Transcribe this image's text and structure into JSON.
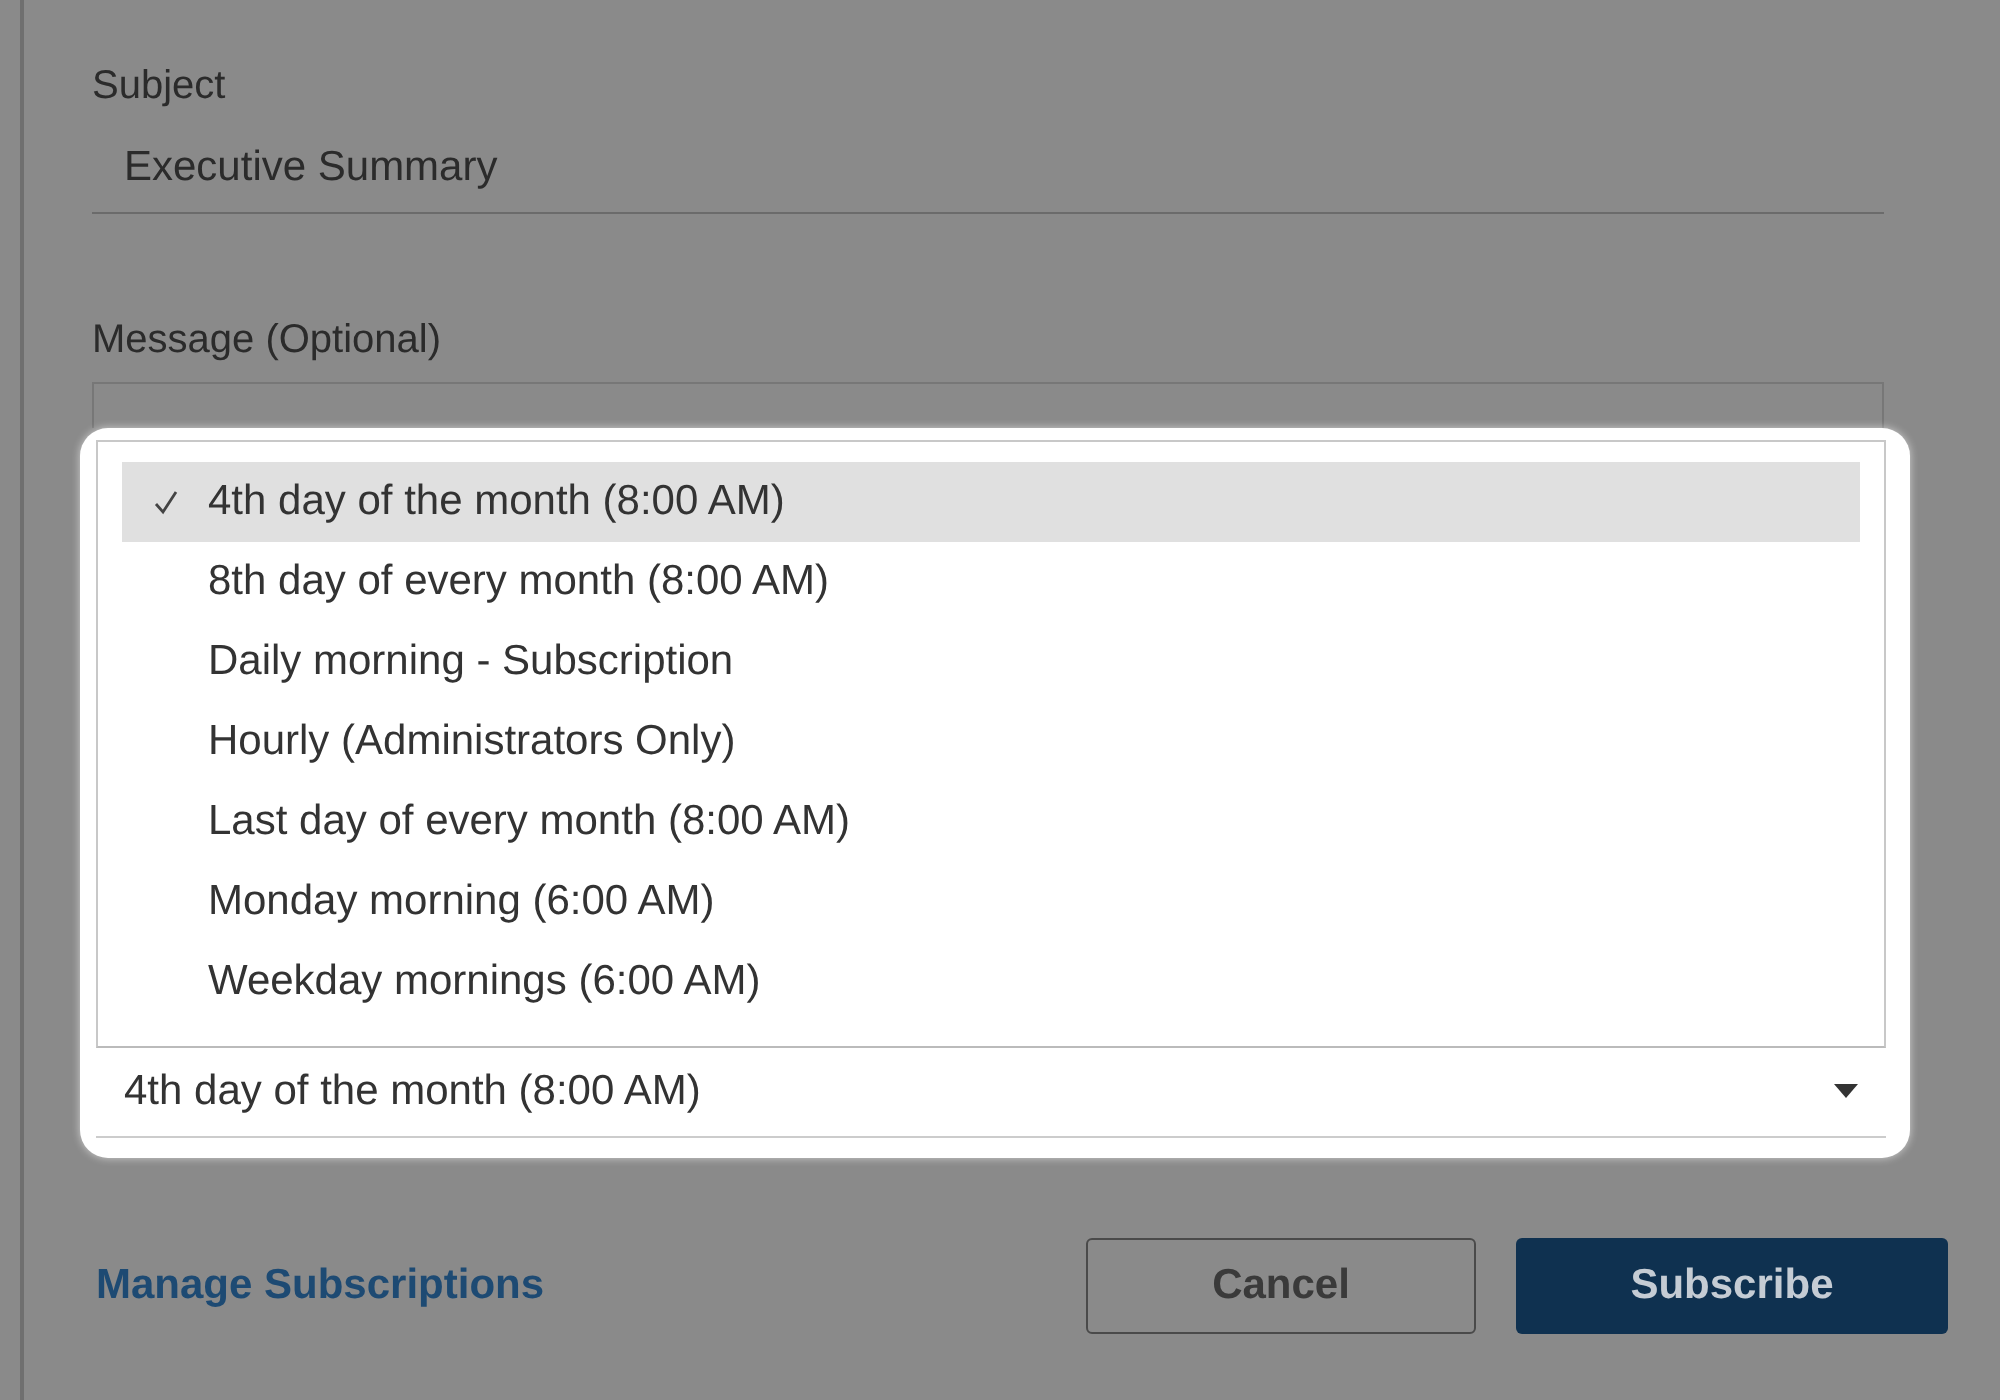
{
  "form": {
    "subject": {
      "label": "Subject",
      "value": "Executive Summary"
    },
    "message": {
      "label": "Message (Optional)"
    },
    "schedule": {
      "value": "4th day of the month (8:00 AM)",
      "options": [
        {
          "label": "4th day of the month (8:00 AM)",
          "selected": true
        },
        {
          "label": "8th day of every month (8:00 AM)",
          "selected": false
        },
        {
          "label": "Daily morning - Subscription",
          "selected": false
        },
        {
          "label": "Hourly (Administrators Only)",
          "selected": false
        },
        {
          "label": "Last day of every month (8:00 AM)",
          "selected": false
        },
        {
          "label": "Monday morning (6:00 AM)",
          "selected": false
        },
        {
          "label": "Weekday mornings (6:00 AM)",
          "selected": false
        }
      ]
    }
  },
  "footer": {
    "link": "Manage Subscriptions",
    "buttons": [
      {
        "label": "Cancel",
        "kind": "secondary"
      },
      {
        "label": "Subscribe",
        "kind": "primary"
      }
    ]
  }
}
